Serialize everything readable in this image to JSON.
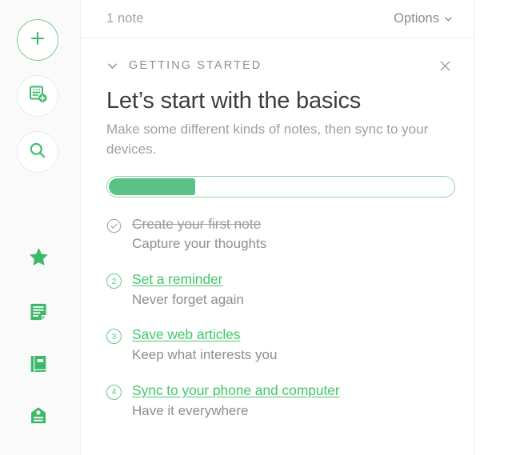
{
  "colors": {
    "brand_green": "#44c76a",
    "progress_fill": "#5cc185",
    "progress_border": "#8ad8a5",
    "icon_green": "#3eb96a",
    "text_dark": "#3d3d3d",
    "text_muted": "#8e8e8e",
    "divider": "#ededed",
    "rail_bg": "#fafafa"
  },
  "sidebar": {
    "buttons": [
      {
        "name": "new-quick-note-button",
        "icon": "plus-icon"
      },
      {
        "name": "new-note-button",
        "icon": "note-add-icon"
      },
      {
        "name": "search-button",
        "icon": "search-icon"
      }
    ],
    "nav": [
      {
        "name": "shortcuts",
        "icon": "star-icon"
      },
      {
        "name": "notes",
        "icon": "note-icon"
      },
      {
        "name": "notebooks",
        "icon": "notebook-icon"
      },
      {
        "name": "tags",
        "icon": "tag-icon"
      }
    ]
  },
  "list_header": {
    "note_count": "1 note",
    "options_label": "Options",
    "options_chevron": "chevron-down-icon"
  },
  "getting_started": {
    "section_label": "GETTING STARTED",
    "collapse_icon": "chevron-down-icon",
    "close_icon": "close-icon",
    "heading": "Let’s start with the basics",
    "subtitle": "Make some different kinds of notes, then sync to your devices.",
    "progress": {
      "completed": 1,
      "total": 4,
      "percent": 25
    },
    "tasks": [
      {
        "number": "1",
        "marker": "check-circle-icon",
        "state": "done",
        "title": "Create your first note",
        "description": "Capture your thoughts"
      },
      {
        "number": "2",
        "marker": "number-circle",
        "state": "todo",
        "title": "Set a reminder",
        "description": "Never forget again"
      },
      {
        "number": "3",
        "marker": "number-circle",
        "state": "todo",
        "title": "Save web articles",
        "description": "Keep what interests you"
      },
      {
        "number": "4",
        "marker": "number-circle",
        "state": "todo",
        "title": "Sync to your phone and computer",
        "description": "Have it everywhere"
      }
    ]
  }
}
